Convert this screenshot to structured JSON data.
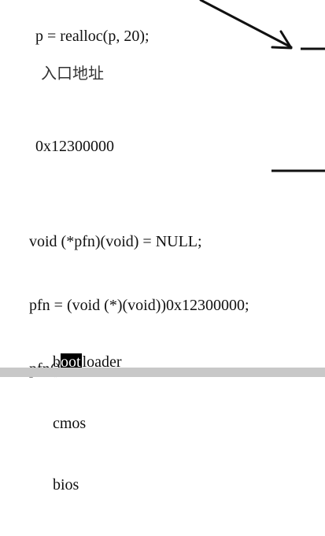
{
  "slide": {
    "realloc_line": "p = realloc(p, 20);",
    "entry_address_label": "入口地址",
    "address_value": "0x12300000",
    "code_lines": [
      "void (*pfn)(void) = NULL;",
      "pfn = (void (*)(void))0x12300000;",
      "pfn();"
    ],
    "boot_list": {
      "bootloader_prefix": "b",
      "bootloader_selected": "oot",
      "bootloader_suffix": "loader",
      "item_cmos": "cmos",
      "item_bios": "bios"
    }
  },
  "colors": {
    "background": "#ffffff",
    "text": "#111111",
    "selection_background": "#000000",
    "selection_text": "#ffffff",
    "bottom_bar": "#c8c8c8",
    "arrow": "#111111"
  },
  "icons": {
    "arrow": "arrow-icon"
  }
}
